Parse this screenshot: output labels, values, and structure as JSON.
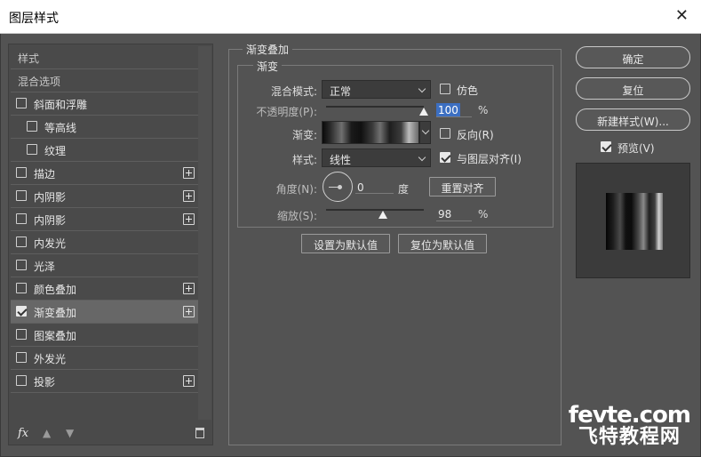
{
  "window": {
    "title": "图层样式",
    "close_icon": "close-icon"
  },
  "sidebar": {
    "items": [
      {
        "label": "样式",
        "checkbox": false,
        "checked": false,
        "plus": false,
        "indent": false,
        "selected": false
      },
      {
        "label": "混合选项",
        "checkbox": false,
        "checked": false,
        "plus": false,
        "indent": false,
        "selected": false
      },
      {
        "label": "斜面和浮雕",
        "checkbox": true,
        "checked": false,
        "plus": false,
        "indent": false,
        "selected": false
      },
      {
        "label": "等高线",
        "checkbox": true,
        "checked": false,
        "plus": false,
        "indent": true,
        "selected": false
      },
      {
        "label": "纹理",
        "checkbox": true,
        "checked": false,
        "plus": false,
        "indent": true,
        "selected": false
      },
      {
        "label": "描边",
        "checkbox": true,
        "checked": false,
        "plus": true,
        "indent": false,
        "selected": false
      },
      {
        "label": "内阴影",
        "checkbox": true,
        "checked": false,
        "plus": true,
        "indent": false,
        "selected": false
      },
      {
        "label": "内阴影",
        "checkbox": true,
        "checked": false,
        "plus": true,
        "indent": false,
        "selected": false
      },
      {
        "label": "内发光",
        "checkbox": true,
        "checked": false,
        "plus": false,
        "indent": false,
        "selected": false
      },
      {
        "label": "光泽",
        "checkbox": true,
        "checked": false,
        "plus": false,
        "indent": false,
        "selected": false
      },
      {
        "label": "颜色叠加",
        "checkbox": true,
        "checked": false,
        "plus": true,
        "indent": false,
        "selected": false
      },
      {
        "label": "渐变叠加",
        "checkbox": true,
        "checked": true,
        "plus": true,
        "indent": false,
        "selected": true
      },
      {
        "label": "图案叠加",
        "checkbox": true,
        "checked": false,
        "plus": false,
        "indent": false,
        "selected": false
      },
      {
        "label": "外发光",
        "checkbox": true,
        "checked": false,
        "plus": false,
        "indent": false,
        "selected": false
      },
      {
        "label": "投影",
        "checkbox": true,
        "checked": false,
        "plus": true,
        "indent": false,
        "selected": false
      }
    ],
    "bottom": {
      "fx_label": "fx",
      "fx_icon": "fx-icon",
      "up_icon": "arrow-up-icon",
      "down_icon": "arrow-down-icon",
      "trash_icon": "trash-icon"
    }
  },
  "gradient_overlay": {
    "group_title": "渐变叠加",
    "section_title": "渐变",
    "blend_mode_label": "混合模式:",
    "blend_mode_value": "正常",
    "dither_label": "仿色",
    "dither_checked": false,
    "opacity_label": "不透明度(P):",
    "opacity_value": "100",
    "opacity_unit": "%",
    "opacity_slider": 1.0,
    "gradient_label": "渐变:",
    "reverse_label": "反向(R)",
    "reverse_checked": false,
    "style_label": "样式:",
    "style_value": "线性",
    "align_label": "与图层对齐(I)",
    "align_checked": true,
    "angle_label": "角度(N):",
    "angle_value": "0",
    "angle_unit": "度",
    "reset_align_label": "重置对齐",
    "scale_label": "缩放(S):",
    "scale_value": "98",
    "scale_unit": "%",
    "scale_slider": 0.49,
    "make_default_label": "设置为默认值",
    "reset_default_label": "复位为默认值"
  },
  "right": {
    "ok_label": "确定",
    "reset_label": "复位",
    "new_style_label": "新建样式(W)...",
    "preview_label": "预览(V)",
    "preview_checked": true
  },
  "watermark": {
    "line1": "fevte.com",
    "line2": "飞特教程网"
  }
}
